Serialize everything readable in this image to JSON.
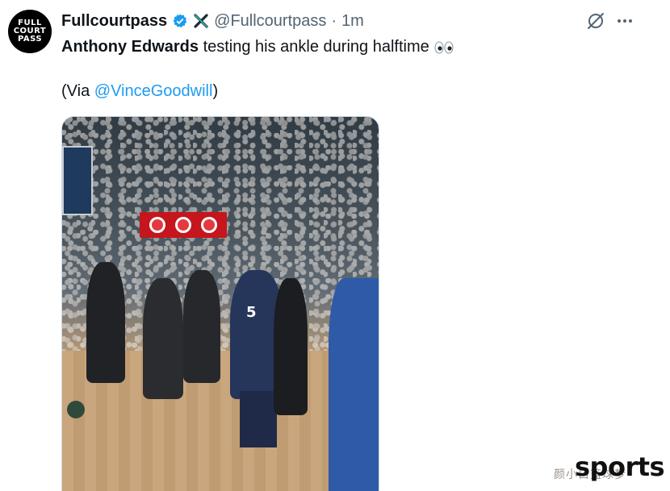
{
  "author": {
    "avatar_lines": [
      "FULL",
      "COURT",
      "PASS"
    ],
    "display_name": "Fullcourtpass",
    "handle": "@Fullcourtpass",
    "separator": "·",
    "time": "1m"
  },
  "tweet": {
    "subject": "Anthony Edwards",
    "text_rest": " testing his ankle during halftime",
    "emoji": "eyes",
    "via_prefix": "(Via ",
    "via_mention": "@VinceGoodwill",
    "via_suffix": ")"
  },
  "media": {
    "jersey_text": "5"
  },
  "watermark": {
    "brand": "sports",
    "cn": "颜小白篮球梦"
  },
  "icons": {
    "verified": "verified-badge-icon",
    "affiliate": "x-affiliate-icon",
    "grok": "grok-icon",
    "more": "more-options-icon"
  },
  "colors": {
    "link": "#1d9bf0",
    "secondary_text": "#536471",
    "verified": "#1d9bf0"
  }
}
